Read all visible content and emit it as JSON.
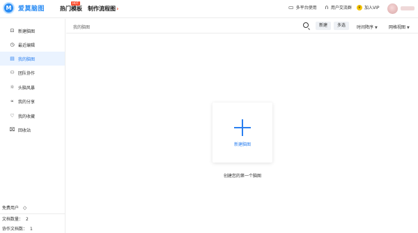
{
  "app": {
    "logo_mark": "M",
    "name": "爱莫脑图"
  },
  "header": {
    "nav_hot": "热门模板",
    "hot_badge": "HOT",
    "nav_flow": "制作流程图",
    "multi_platform": "多平台使用",
    "user_group": "用户交流群",
    "join_vip": "加入VIP"
  },
  "sidebar": {
    "items": [
      {
        "label": "新建脑图",
        "icon": "new-mindmap-icon"
      },
      {
        "label": "最近编辑",
        "icon": "clock-icon"
      },
      {
        "label": "我的脑图",
        "icon": "document-icon"
      },
      {
        "label": "团队协作",
        "icon": "team-icon"
      },
      {
        "label": "头脑风暴",
        "icon": "lightbulb-icon"
      },
      {
        "label": "我的分享",
        "icon": "share-icon"
      },
      {
        "label": "我的收藏",
        "icon": "heart-icon"
      },
      {
        "label": "回收站",
        "icon": "trash-icon"
      }
    ],
    "active_index": 2,
    "free_user": "免费用户",
    "doc_count_label": "文档数量：",
    "doc_count": "2",
    "collab_count_label": "协作文档数：",
    "collab_count": "1"
  },
  "content": {
    "breadcrumb": "我的脑图",
    "new_button": "新建",
    "multi_select_button": "多选",
    "sort_dropdown": "时间降序",
    "view_dropdown": "网格视图",
    "card_label": "新建脑图",
    "empty_hint": "创建您的第一个脑图"
  },
  "colors": {
    "brand_blue": "#2a7ff0",
    "hot_red": "#ff4d2e",
    "vip_yellow": "#f5c400"
  }
}
